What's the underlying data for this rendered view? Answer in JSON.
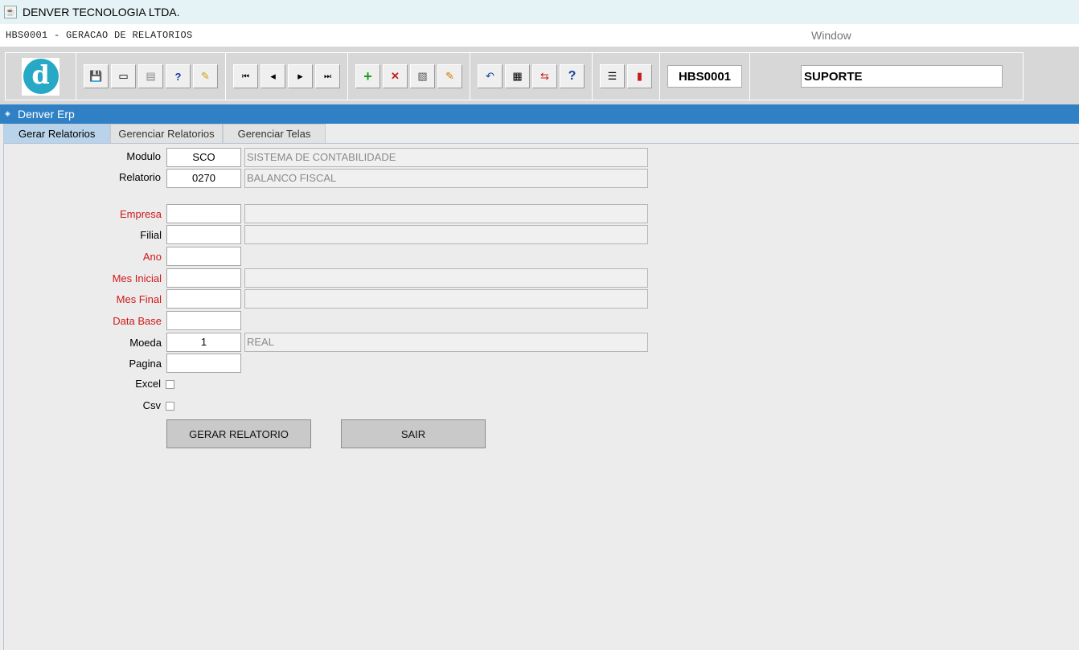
{
  "window": {
    "title": "DENVER TECNOLOGIA LTDA."
  },
  "menubar": {
    "form_title": "HBS0001 - GERACAO DE RELATORIOS",
    "window_menu": "Window"
  },
  "toolbar": {
    "logo_letter": "d",
    "form_code": "HBS0001",
    "user": "SUPORTE",
    "icons": {
      "save": "💾",
      "enter_query": "▭",
      "print": "▤",
      "query_help": "?",
      "edit": "✎",
      "first": "⏮",
      "prev": "◂",
      "next": "▸",
      "last": "⏭",
      "insert": "+",
      "delete": "✕",
      "duplicate": "▧",
      "clear": "✎",
      "undo": "↶",
      "list": "▦",
      "exit_field": "⇆",
      "help": "?",
      "menu": "☰",
      "exit": "▮"
    }
  },
  "erp_bar": {
    "title": "Denver Erp"
  },
  "tabs": [
    {
      "label": "Gerar Relatorios"
    },
    {
      "label": "Gerenciar Relatorios"
    },
    {
      "label": "Gerenciar Telas"
    }
  ],
  "form": {
    "modulo": {
      "label": "Modulo",
      "code": "SCO",
      "desc": "SISTEMA DE CONTABILIDADE"
    },
    "relatorio": {
      "label": "Relatorio",
      "code": "0270",
      "desc": "BALANCO FISCAL"
    },
    "empresa": {
      "label": "Empresa",
      "code": "",
      "desc": ""
    },
    "filial": {
      "label": "Filial",
      "code": "",
      "desc": ""
    },
    "ano": {
      "label": "Ano",
      "code": ""
    },
    "mes_inicial": {
      "label": "Mes Inicial",
      "code": "",
      "desc": ""
    },
    "mes_final": {
      "label": "Mes Final",
      "code": "",
      "desc": ""
    },
    "data_base": {
      "label": "Data Base",
      "code": ""
    },
    "moeda": {
      "label": "Moeda",
      "code": "1",
      "desc": "REAL"
    },
    "pagina": {
      "label": "Pagina",
      "code": ""
    },
    "excel": {
      "label": "Excel",
      "checked": false
    },
    "csv": {
      "label": "Csv",
      "checked": false
    }
  },
  "buttons": {
    "gerar": "GERAR RELATORIO",
    "sair": "SAIR"
  },
  "colors": {
    "erp_bar": "#2f80c4",
    "required_label": "#d01818",
    "active_tab": "#b8d3ea"
  }
}
